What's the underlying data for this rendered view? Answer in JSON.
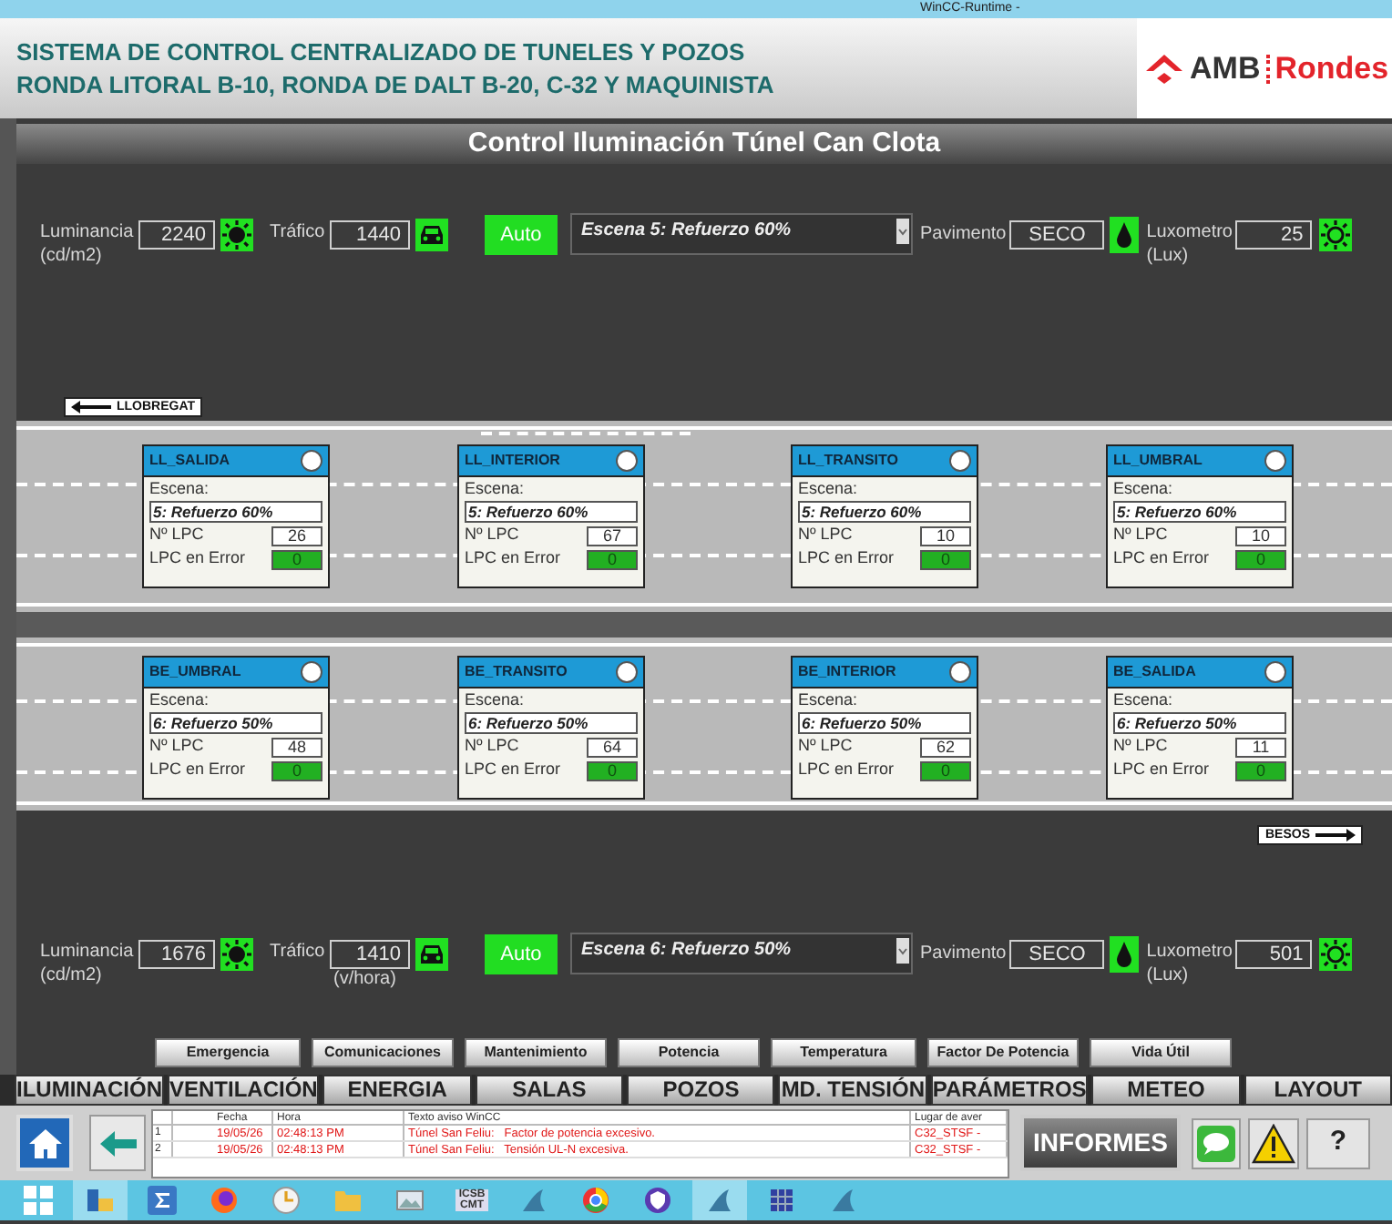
{
  "window": {
    "title": "WinCC-Runtime -"
  },
  "header": {
    "lines": [
      "SISTEMA DE CONTROL CENTRALIZADO DE TUNELES Y POZOS",
      "RONDA LITORAL B-10, RONDA DE DALT B-20, C-32 Y MAQUINISTA"
    ],
    "logo": {
      "brand": "AMB",
      "name": "Rondes"
    }
  },
  "page_title": "Control Iluminación Túnel Can Clota",
  "control_rows": [
    {
      "luminancia": {
        "label": "Luminancia",
        "unit": "(cd/m2)",
        "value": "2240"
      },
      "trafico": {
        "label": "Tráfico",
        "value": "1440"
      },
      "mode": "Auto",
      "scene": "Escena 5: Refuerzo 60%",
      "pavimento": {
        "label": "Pavimento",
        "value": "SECO"
      },
      "luxometro": {
        "label": "Luxometro",
        "unit": "(Lux)",
        "value": "25"
      }
    },
    {
      "luminancia": {
        "label": "Luminancia",
        "unit": "(cd/m2)",
        "value": "1676"
      },
      "trafico": {
        "label": "Tráfico",
        "unit": "(v/hora)",
        "value": "1410"
      },
      "mode": "Auto",
      "scene": "Escena 6: Refuerzo 50%",
      "pavimento": {
        "label": "Pavimento",
        "value": "SECO"
      },
      "luxometro": {
        "label": "Luxometro",
        "unit": "(Lux)",
        "value": "501"
      }
    }
  ],
  "direction_signs": [
    {
      "label": "LLOBREGAT",
      "kind": "left"
    },
    {
      "label": "BESOS",
      "kind": "right"
    }
  ],
  "lanes": [
    {
      "cards": [
        {
          "name": "LL_SALIDA",
          "scene_label": "Escena:",
          "scene": "5: Refuerzo 60%",
          "lpc_label": "Nº LPC",
          "lpc": "26",
          "error_label": "LPC en Error",
          "errors": "0"
        },
        {
          "name": "LL_INTERIOR",
          "scene_label": "Escena:",
          "scene": "5: Refuerzo 60%",
          "lpc_label": "Nº LPC",
          "lpc": "67",
          "error_label": "LPC en Error",
          "errors": "0"
        },
        {
          "name": "LL_TRANSITO",
          "scene_label": "Escena:",
          "scene": "5: Refuerzo 60%",
          "lpc_label": "Nº LPC",
          "lpc": "10",
          "error_label": "LPC en Error",
          "errors": "0"
        },
        {
          "name": "LL_UMBRAL",
          "scene_label": "Escena:",
          "scene": "5: Refuerzo 60%",
          "lpc_label": "Nº LPC",
          "lpc": "10",
          "error_label": "LPC en Error",
          "errors": "0"
        }
      ]
    },
    {
      "cards": [
        {
          "name": "BE_UMBRAL",
          "scene_label": "Escena:",
          "scene": "6: Refuerzo 50%",
          "lpc_label": "Nº LPC",
          "lpc": "48",
          "error_label": "LPC en Error",
          "errors": "0"
        },
        {
          "name": "BE_TRANSITO",
          "scene_label": "Escena:",
          "scene": "6: Refuerzo 50%",
          "lpc_label": "Nº LPC",
          "lpc": "64",
          "error_label": "LPC en Error",
          "errors": "0"
        },
        {
          "name": "BE_INTERIOR",
          "scene_label": "Escena:",
          "scene": "6: Refuerzo 50%",
          "lpc_label": "Nº LPC",
          "lpc": "62",
          "error_label": "LPC en Error",
          "errors": "0"
        },
        {
          "name": "BE_SALIDA",
          "scene_label": "Escena:",
          "scene": "6: Refuerzo 50%",
          "lpc_label": "Nº LPC",
          "lpc": "11",
          "error_label": "LPC en Error",
          "errors": "0"
        }
      ]
    }
  ],
  "sub_buttons": [
    "Emergencia",
    "Comunicaciones",
    "Mantenimiento",
    "Potencia",
    "Temperatura",
    "Factor De Potencia",
    "Vida Útil"
  ],
  "tabs": [
    {
      "label": "ILUMINACIÓN",
      "selected": false
    },
    {
      "label": "VENTILACIÓN",
      "selected": false
    },
    {
      "label": "ENERGIA",
      "selected": false
    },
    {
      "label": "SALAS",
      "selected": false
    },
    {
      "label": "POZOS",
      "selected": false
    },
    {
      "label": "MD. TENSIÓN",
      "selected": false
    },
    {
      "label": "PARÁMETROS",
      "selected": false
    },
    {
      "label": "METEO",
      "selected": false
    },
    {
      "label": "LAYOUT",
      "selected": false
    }
  ],
  "alarms": {
    "columns": [
      "Fecha",
      "Hora",
      "Texto aviso WinCC",
      "Lugar de aver"
    ],
    "rows": [
      {
        "num": "1",
        "cells": [
          "19/05/26",
          "02:48:13 PM",
          "Túnel San Feliu:   Factor de potencia excesivo.",
          "C32_STSF -"
        ]
      },
      {
        "num": "2",
        "cells": [
          "19/05/26",
          "02:48:13 PM",
          "Túnel San Feliu:   Tensión UL-N excesiva.",
          "C32_STSF -"
        ]
      }
    ]
  },
  "reports_button": "INFORMES",
  "help_button": "?",
  "taskbar": [
    {
      "kind": "start",
      "selected": false
    },
    {
      "kind": "explorer",
      "selected": true
    },
    {
      "kind": "sigma",
      "selected": false
    },
    {
      "kind": "fox",
      "selected": false
    },
    {
      "kind": "clock",
      "selected": false
    },
    {
      "kind": "folder",
      "selected": false
    },
    {
      "kind": "image",
      "selected": false
    },
    {
      "kind": "text",
      "text": "ICSB CMT",
      "selected": false
    },
    {
      "kind": "fin",
      "selected": false
    },
    {
      "kind": "ring",
      "selected": false
    },
    {
      "kind": "shield",
      "selected": false
    },
    {
      "kind": "fin",
      "selected": true
    },
    {
      "kind": "grid",
      "selected": false
    },
    {
      "kind": "fin",
      "selected": false
    }
  ]
}
